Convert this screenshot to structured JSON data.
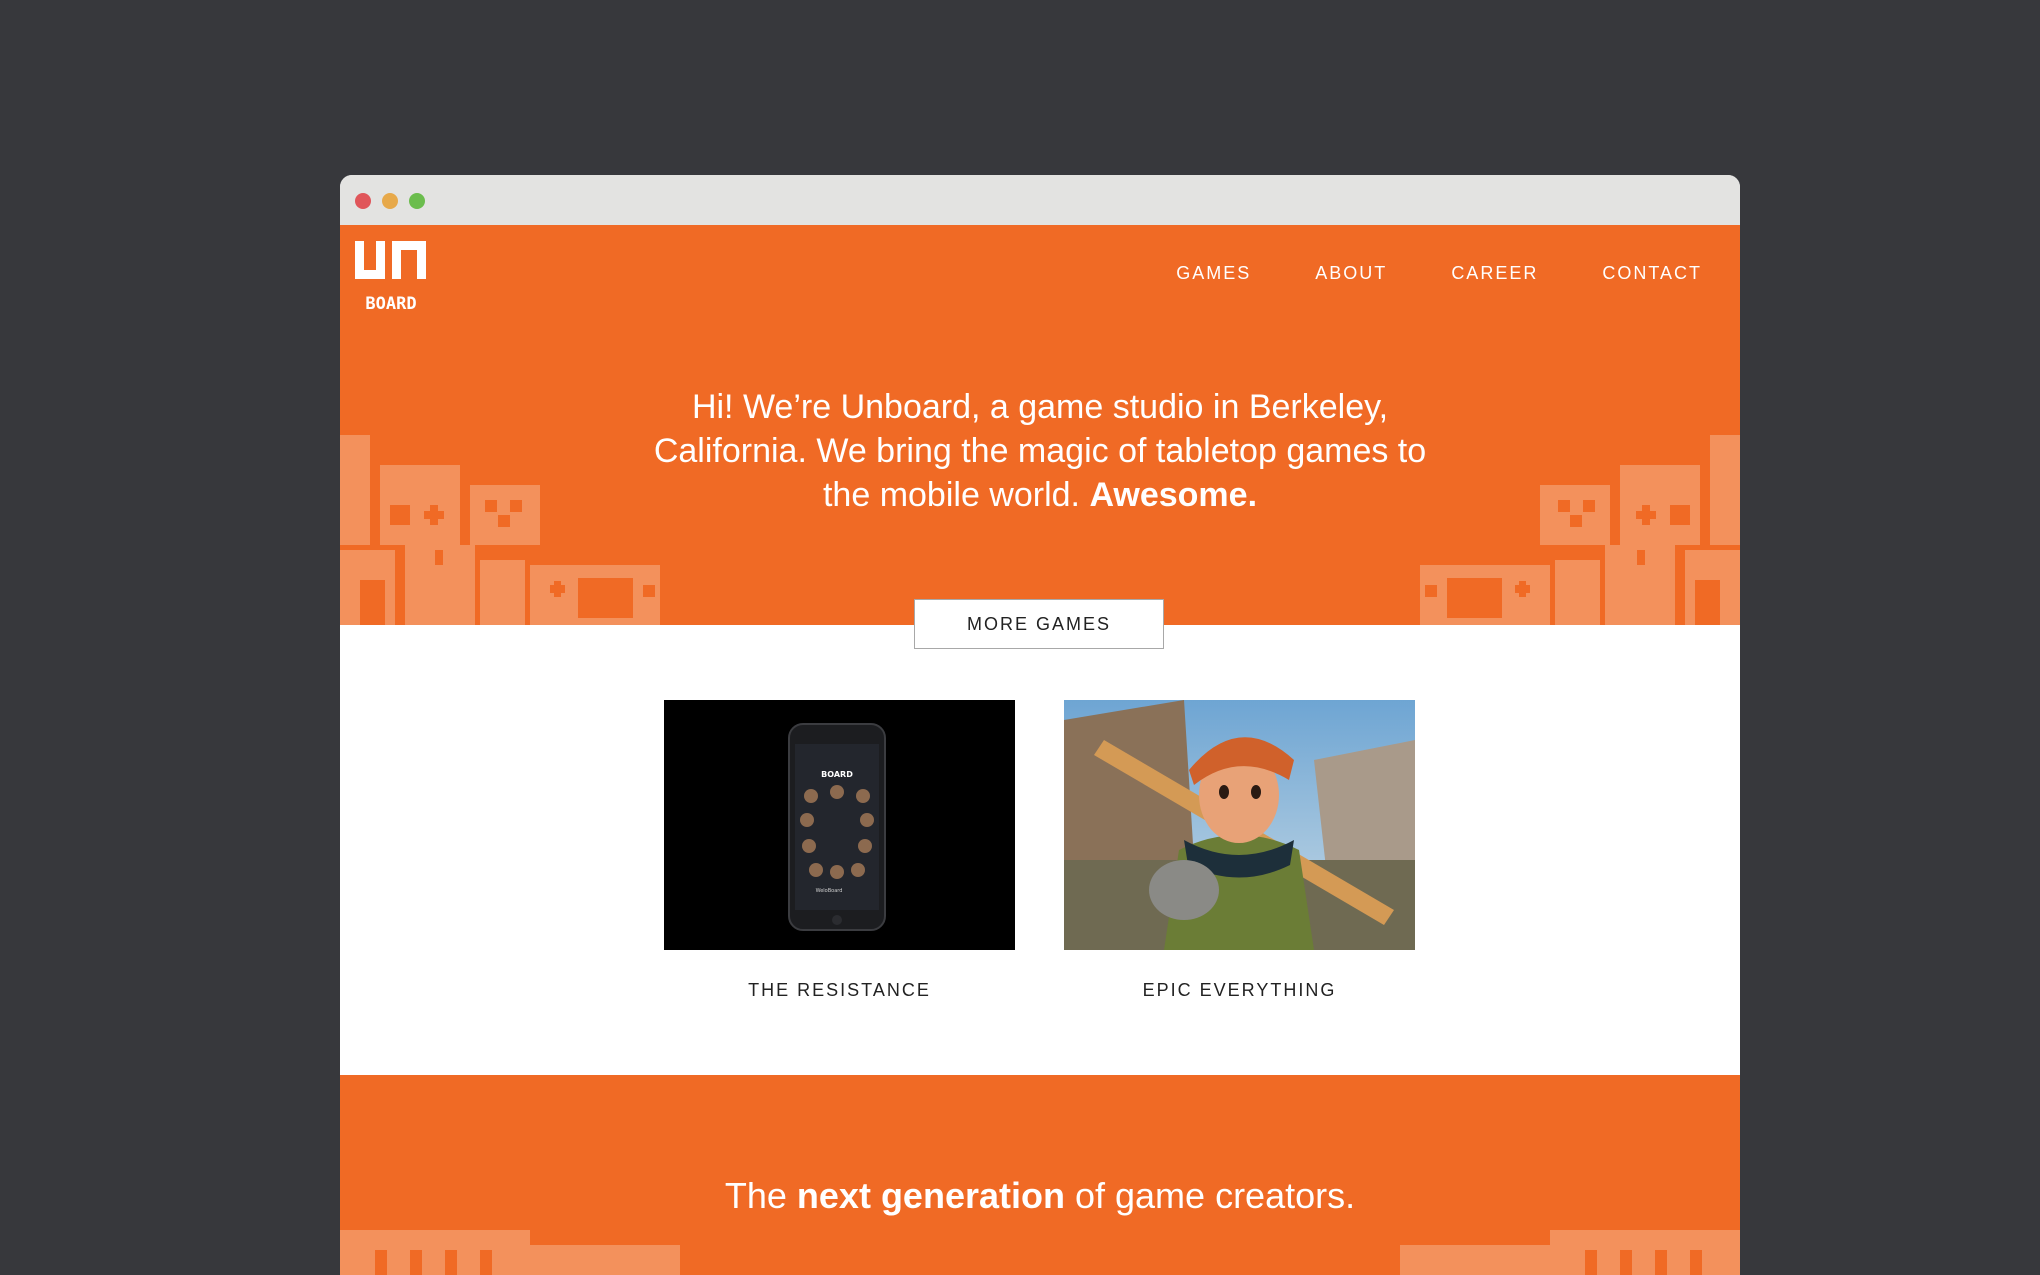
{
  "nav": {
    "games": "GAMES",
    "about": "ABOUT",
    "career": "CAREER",
    "contact": "CONTACT"
  },
  "logo": {
    "top": "UN",
    "bottom": "BOARD"
  },
  "hero": {
    "intro_text": "Hi! We’re Unboard, a game studio in Berkeley, California. We bring the magic of tabletop games to the mobile world. ",
    "intro_emphasis": "Awesome."
  },
  "games": [
    {
      "title": "THE RESISTANCE",
      "phone_header": "BOARD",
      "phone_footer": "WeloBoard"
    },
    {
      "title": "EPIC EVERYTHING"
    }
  ],
  "more_games_label": "MORE GAMES",
  "tagline": {
    "prefix": "The ",
    "emphasis": "next generation",
    "suffix": " of game creators."
  },
  "colors": {
    "brand_orange": "#f06a25",
    "light_orange": "#f3915c",
    "page_background": "#37383c",
    "titlebar": "#e3e3e1"
  }
}
